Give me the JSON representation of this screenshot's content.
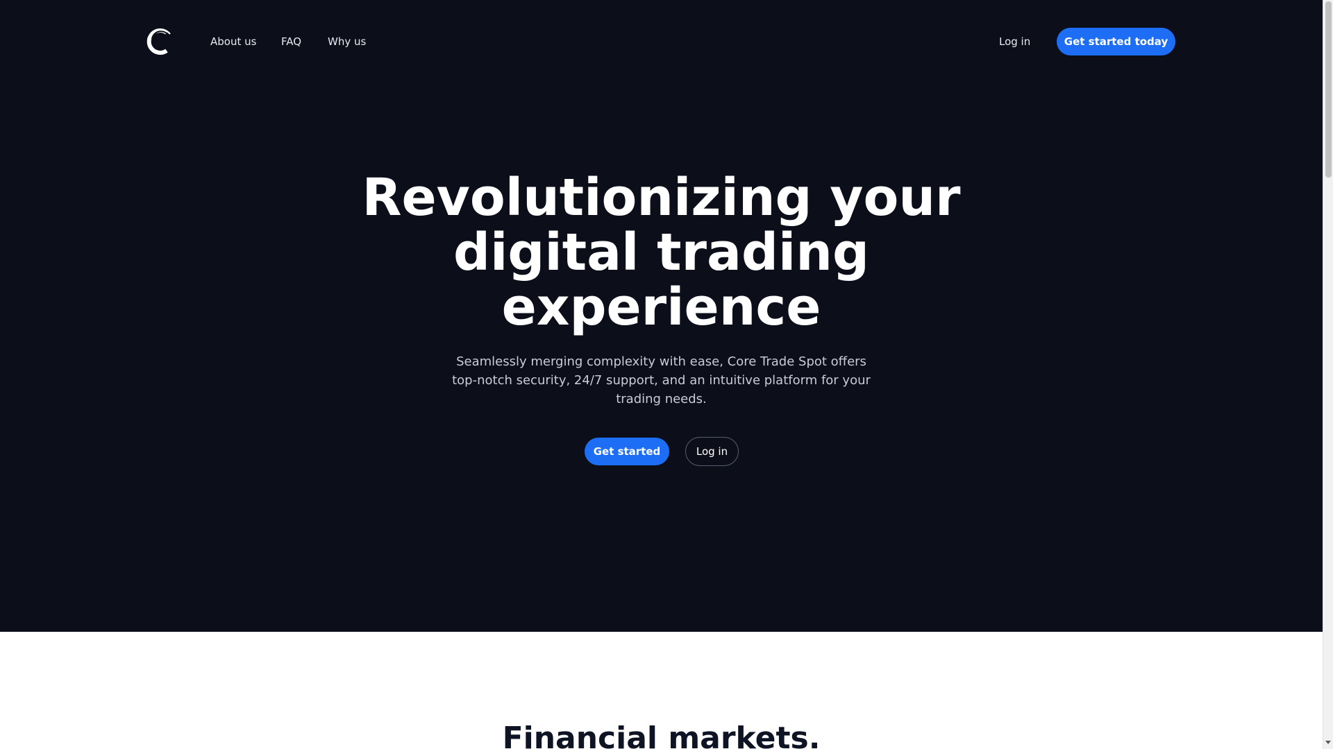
{
  "header": {
    "logo_icon": "c-logo-icon",
    "nav": [
      {
        "label": "About us"
      },
      {
        "label": "FAQ"
      },
      {
        "label": "Why us"
      }
    ],
    "login_label": "Log in",
    "cta_label": "Get started today"
  },
  "hero": {
    "title": "Revolutionizing your digital trading experience",
    "subtitle": "Seamlessly merging complexity with ease, Core Trade Spot offers top-notch security, 24/7 support, and an intuitive platform for your trading needs.",
    "primary_button": "Get started",
    "secondary_button": "Log in"
  },
  "section": {
    "title": "Financial markets."
  },
  "colors": {
    "hero_background": "#0c0f1a",
    "accent": "#1d6ef5",
    "text_light": "#ffffff",
    "section_title": "#0f1424"
  }
}
